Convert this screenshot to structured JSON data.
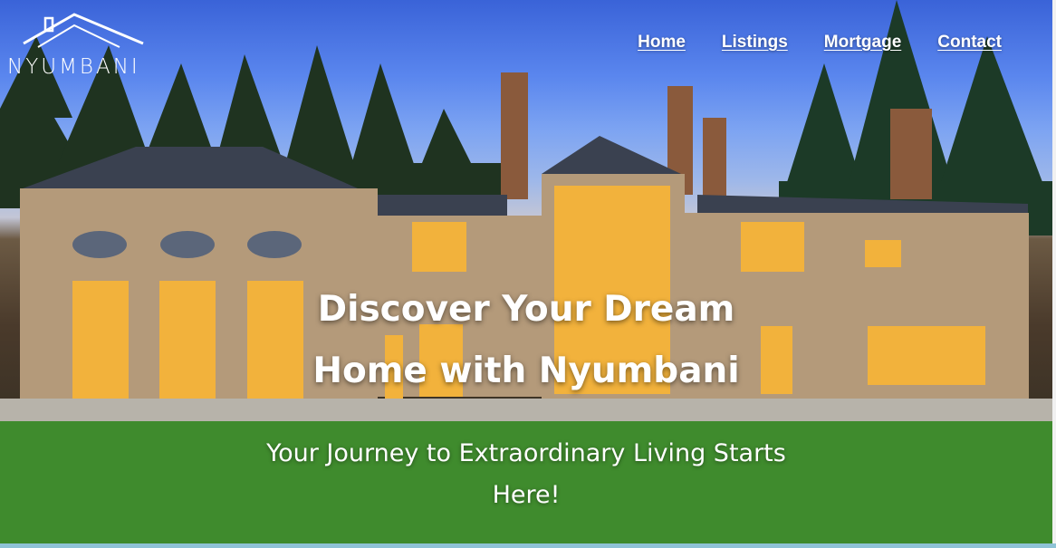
{
  "brand": {
    "name": "NYUMBANI",
    "logo_icon": "house-roof-icon"
  },
  "nav": {
    "items": [
      {
        "label": "Home"
      },
      {
        "label": "Listings"
      },
      {
        "label": "Mortgage"
      },
      {
        "label": "Contact"
      }
    ]
  },
  "hero": {
    "headline": "Discover Your Dream Home with Nyumbani",
    "subheadline": "Your Journey to Extraordinary Living Starts Here!",
    "background": "luxury stone mansion at dusk with lit windows, pine trees, lawn"
  },
  "colors": {
    "text": "#ffffff",
    "sky": "#5a86ee",
    "lawn": "#3e8a2c",
    "bottom_strip": "#8fc3d6"
  }
}
